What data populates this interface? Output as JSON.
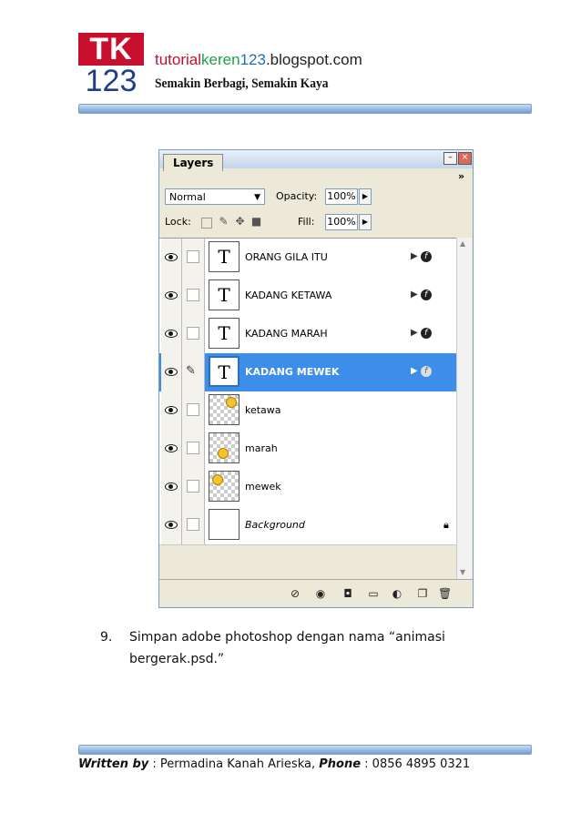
{
  "header": {
    "logo_top": "TK",
    "logo_bottom": "123",
    "site_part1": "tutorial",
    "site_part2": "keren",
    "site_part3": "123",
    "site_part4": ".blogspot.com",
    "tagline": "Semakin Berbagi, Semakin Kaya"
  },
  "panel": {
    "tab": "Layers",
    "blend_mode": "Normal",
    "opacity_label": "Opacity:",
    "opacity_value": "100%",
    "lock_label": "Lock:",
    "fill_label": "Fill:",
    "fill_value": "100%",
    "layers": [
      {
        "name": "ORANG GILA ITU",
        "type": "text",
        "fx": true
      },
      {
        "name": "KADANG KETAWA",
        "type": "text",
        "fx": true
      },
      {
        "name": "KADANG MARAH",
        "type": "text",
        "fx": true
      },
      {
        "name": "KADANG MEWEK",
        "type": "text",
        "fx": true,
        "selected": true
      },
      {
        "name": "ketawa",
        "type": "image"
      },
      {
        "name": "marah",
        "type": "image"
      },
      {
        "name": "mewek",
        "type": "image"
      },
      {
        "name": "Background",
        "type": "background",
        "locked": true
      }
    ],
    "fx_symbol": "▶",
    "fx_letter": "f"
  },
  "step": {
    "number": "9.",
    "text": "Simpan adobe photoshop dengan nama “animasi bergerak.psd.”"
  },
  "footer": {
    "written_by_label": "Written by",
    "author": " : Permadina Kanah Arieska, ",
    "phone_label": "Phone",
    "phone": " : 0856 4895 0321"
  }
}
